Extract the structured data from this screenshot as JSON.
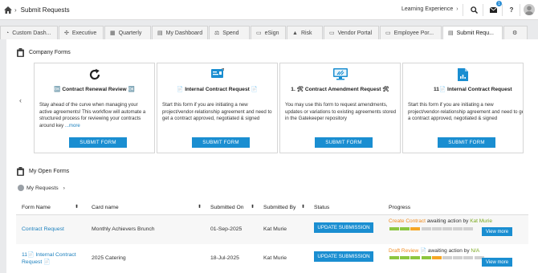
{
  "topbar": {
    "breadcrumb": "Submit Requests",
    "learning_label": "Learning Experience",
    "notification_count": "1",
    "help_label": "?"
  },
  "tabs": [
    {
      "label": "Custom Dash...",
      "icon": "speedometer-icon"
    },
    {
      "label": "Executive",
      "icon": "executive-icon"
    },
    {
      "label": "Quarterly",
      "icon": "grid-icon"
    },
    {
      "label": "My Dashboard",
      "icon": "folder-icon"
    },
    {
      "label": "Spend",
      "icon": "scales-icon"
    },
    {
      "label": "eSign",
      "icon": "document-icon"
    },
    {
      "label": "Risk",
      "icon": "warning-icon"
    },
    {
      "label": "Vendor Portal",
      "icon": "monitor-icon"
    },
    {
      "label": "Employee Por...",
      "icon": "monitor-icon"
    },
    {
      "label": "Submit Requ...",
      "icon": "file-icon"
    }
  ],
  "company_forms": {
    "title": "Company Forms",
    "cards": [
      {
        "title": "🆗 Contract Renewal Review 🆗",
        "description": "Stay ahead of the curve when managing your active agreements! This workflow will automate a structured process for reviewing your contracts around key ",
        "more": "...more",
        "button": "SUBMIT FORM",
        "icon": "refresh-icon"
      },
      {
        "title": "📄 Internal Contract Request 📄",
        "description": "Start this form if you are initiating a new project/vendor-relationship agreement and need to get a contract approved, negotiated & signed",
        "more": "",
        "button": "SUBMIT FORM",
        "icon": "card-icon"
      },
      {
        "title": "1. 🛠 Contract Amendment Request 🛠",
        "description": "You may use this form to request amendments, updates or variations to existing agreements stored in the Gatekeeper repository",
        "more": "",
        "button": "SUBMIT FORM",
        "icon": "monitor-tools-icon"
      },
      {
        "title": "11📄 Internal Contract Request",
        "description": "Start this form if you are initiating a new project/vendor-relationship agreement and need to get a contract approved, negotiated & signed",
        "more": "",
        "button": "SUBMIT FORM",
        "icon": "file-chart-icon"
      }
    ]
  },
  "open_forms": {
    "title": "My Open Forms",
    "my_requests": "My Requests",
    "columns": [
      "Form Name",
      "Card name",
      "Submitted On",
      "Submitted By",
      "Status",
      "Progress"
    ],
    "rows": [
      {
        "form_name": "Contract Request",
        "card_name": "Monthly Achievers Brunch",
        "submitted_on": "01-Sep-2025",
        "submitted_by": "Kat Murie",
        "status_button": "UPDATE SUBMISSION",
        "progress_stage": "Create Contract",
        "progress_mid": " awaiting action by ",
        "progress_person": "Kat Murie",
        "progress_segments": [
          "#8cc63f",
          "#8cc63f",
          "#f5a623",
          "#d0d0d0",
          "#d0d0d0",
          "#d0d0d0",
          "#d0d0d0",
          "#d0d0d0"
        ],
        "view_more": "View more"
      },
      {
        "form_name_line1": "11📄 Internal Contract",
        "form_name_line2": "Request 📄",
        "card_name": "2025 Catering",
        "submitted_on": "18-Jul-2025",
        "submitted_by": "Kat Murie",
        "status_button": "UPDATE SUBMISSION",
        "progress_stage": "Draft Review 📄",
        "progress_mid": " awaiting action by ",
        "progress_person": "N/A",
        "progress_segments": [
          "#8cc63f",
          "#8cc63f",
          "#8cc63f",
          "#8cc63f",
          "#f5a623",
          "#d0d0d0",
          "#d0d0d0",
          "#d0d0d0",
          "#d0d0d0"
        ],
        "view_more": "View more"
      }
    ]
  }
}
